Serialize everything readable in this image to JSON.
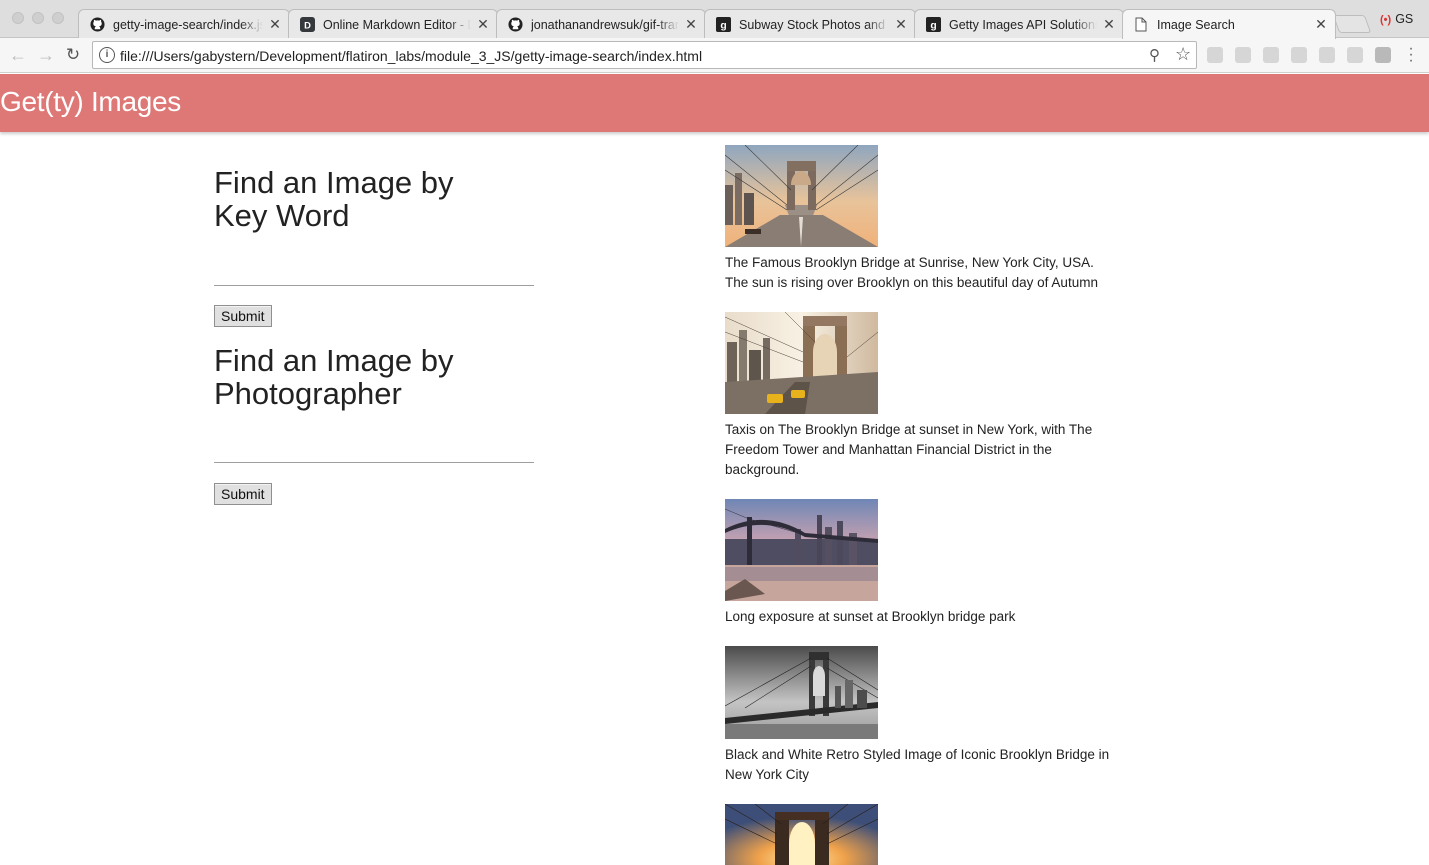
{
  "browser": {
    "tabs": [
      {
        "title": "getty-image-search/index.js",
        "icon": "github-icon"
      },
      {
        "title": "Online Markdown Editor - Dillinger",
        "icon": "dillinger-icon"
      },
      {
        "title": "jonathanandrewsuk/gif-transitions",
        "icon": "github-icon"
      },
      {
        "title": "Subway Stock Photos and Pictures",
        "icon": "getty-icon"
      },
      {
        "title": "Getty Images API Solutions",
        "icon": "getty-icon"
      },
      {
        "title": "Image Search",
        "icon": "document-icon"
      }
    ],
    "profile": "GS",
    "address": "file:///Users/gabystern/Development/flatiron_labs/module_3_JS/getty-image-search/index.html"
  },
  "app": {
    "title": "Get(ty) Images"
  },
  "search": {
    "keyword_heading": "Find an Image by Key Word",
    "keyword_value": "",
    "photographer_heading": "Find an Image by Photographer",
    "photographer_value": "",
    "submit_label": "Submit"
  },
  "results": [
    {
      "caption": "The Famous Brooklyn Bridge at Sunrise, New York City, USA. The sun is rising over Brooklyn on this beautiful day of Autumn"
    },
    {
      "caption": "Taxis on The Brooklyn Bridge at sunset in New York, with The Freedom Tower and Manhattan Financial District in the background."
    },
    {
      "caption": "Long exposure at sunset at Brooklyn bridge park"
    },
    {
      "caption": "Black and White Retro Styled Image of Iconic Brooklyn Bridge in New York City"
    },
    {
      "caption": ""
    }
  ],
  "colors": {
    "appbar": "#de7876"
  }
}
